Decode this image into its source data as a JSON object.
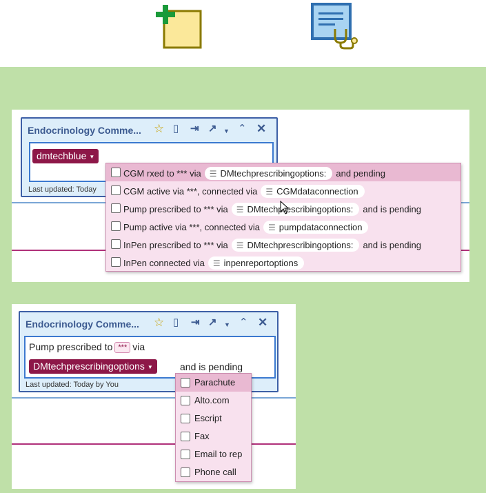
{
  "colors": {
    "accent_green": "#bfe0a8",
    "token_maroon": "#8d1748",
    "note_border": "#3d5fa6",
    "dropdown_bg": "#f8e1ee",
    "dropdown_highlight": "#e9b9d2"
  },
  "toolbar": {
    "new_note_icon": "add-note-icon",
    "clinical_note_icon": "document-stethoscope-icon"
  },
  "note1": {
    "title": "Endocrinology Comme...",
    "token_label": "dmtechblue",
    "footer": "Last updated: Today",
    "options": [
      {
        "prefix": "CGM rxed to *** via",
        "pill": "DMtechprescribingoptions:",
        "suffix": "and pending"
      },
      {
        "prefix": "CGM active via ***, connected via",
        "pill": "CGMdataconnection",
        "suffix": ""
      },
      {
        "prefix": "Pump prescribed to *** via",
        "pill": "DMtechprescribingoptions:",
        "suffix": "and is pending"
      },
      {
        "prefix": "Pump active via ***, connected via",
        "pill": "pumpdataconnection",
        "suffix": ""
      },
      {
        "prefix": "InPen prescribed to *** via",
        "pill": "DMtechprescribingoptions:",
        "suffix": "and is pending"
      },
      {
        "prefix": "InPen connected via",
        "pill": "inpenreportoptions",
        "suffix": ""
      }
    ]
  },
  "note2": {
    "title": "Endocrinology Comme...",
    "line1_prefix": "Pump prescribed to",
    "line1_box": "***",
    "line1_suffix": "via",
    "token_label": "DMtechprescribingoptions",
    "line2_suffix": "and is pending",
    "footer": "Last updated: Today by You",
    "options": [
      "Parachute",
      "Alto.com",
      "Escript",
      "Fax",
      "Email to rep",
      "Phone call"
    ]
  }
}
